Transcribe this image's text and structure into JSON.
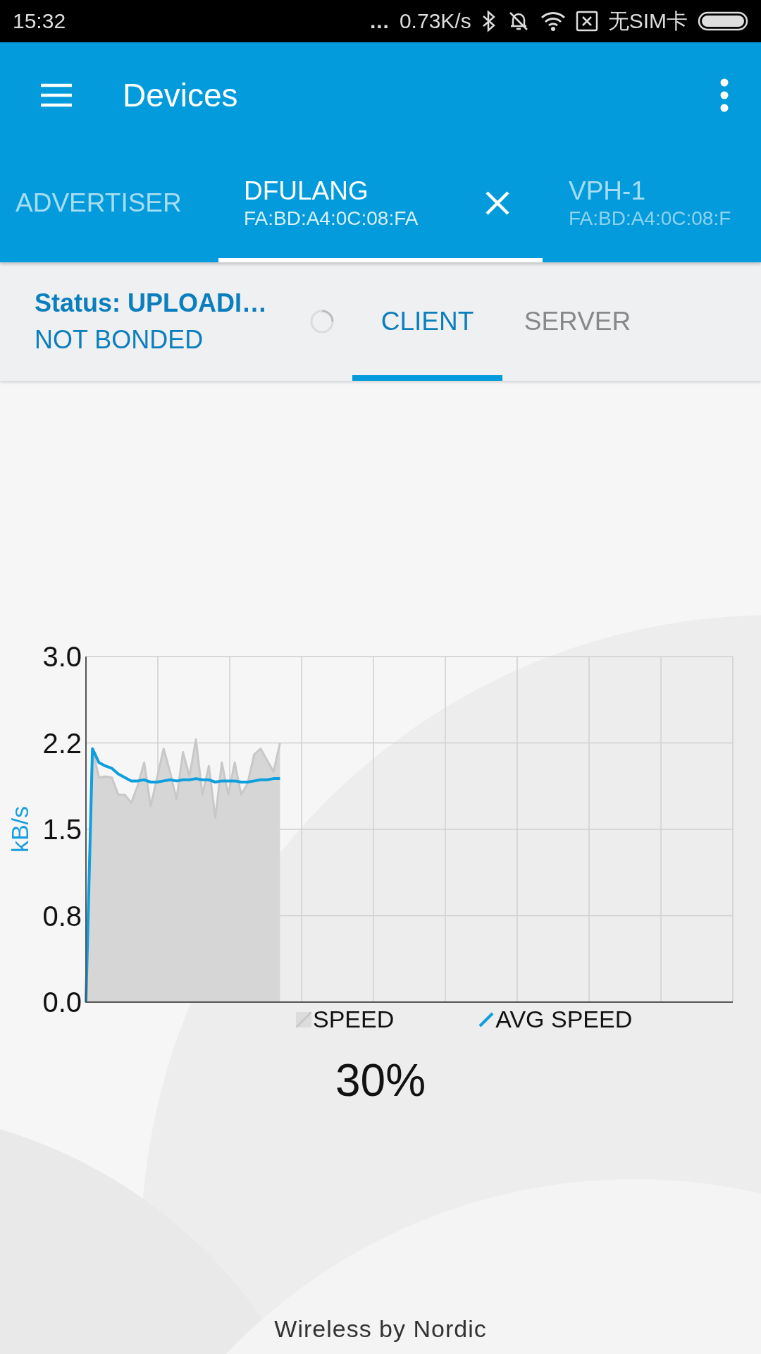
{
  "status_bar": {
    "time": "15:32",
    "dots": "...",
    "speed": "0.73K/s",
    "sim": "无SIM卡"
  },
  "app_bar": {
    "title": "Devices"
  },
  "device_tabs": [
    {
      "label": "ADVERTISER",
      "selected": false,
      "closable": false
    },
    {
      "label": "DFULANG",
      "address": "FA:BD:A4:0C:08:FA",
      "selected": true,
      "closable": true
    },
    {
      "label": "VPH-1",
      "address": "FA:BD:A4:0C:08:F",
      "selected": false,
      "closable": false
    }
  ],
  "connection": {
    "status": "Status: UPLOADI…",
    "bond": "NOT BONDED",
    "busy": true
  },
  "mode_tabs": [
    {
      "label": "CLIENT",
      "selected": true
    },
    {
      "label": "SERVER",
      "selected": false
    }
  ],
  "chart_data": {
    "type": "line",
    "ylabel": "kB/s",
    "grid": true,
    "legend": true,
    "ylim": [
      0,
      3
    ],
    "yticks": [
      {
        "value": 0,
        "label": "0.0"
      },
      {
        "value": 0.75,
        "label": "0.8"
      },
      1.5,
      {
        "value": 2.25,
        "label": "2.2"
      },
      {
        "value": 3,
        "label": "3.0"
      }
    ],
    "categories": [
      null,
      null,
      null,
      null,
      null,
      null,
      null,
      null,
      null,
      null,
      null,
      null,
      null,
      null,
      null,
      null,
      null,
      null,
      null,
      null,
      null,
      null,
      null,
      null,
      null,
      null,
      null,
      null,
      null,
      null,
      null,
      null,
      null,
      null,
      null,
      null,
      null,
      null,
      null,
      null,
      null,
      null,
      null,
      null,
      null,
      null,
      null,
      null,
      null,
      null,
      null,
      null,
      null,
      null,
      null,
      null,
      null,
      null,
      null,
      null,
      null,
      null,
      null,
      null,
      null,
      null,
      null,
      null,
      null,
      null,
      null,
      null,
      null,
      null,
      null,
      null,
      null,
      null,
      null,
      null,
      null,
      null,
      null,
      null,
      null,
      null,
      null,
      null,
      null,
      null,
      null,
      null,
      null,
      null,
      null,
      null,
      null,
      null,
      null,
      null,
      null
    ],
    "series": [
      {
        "name": "SPEED",
        "color": "#c8c8c8",
        "values": [
          0,
          2.2,
          1.95,
          1.96,
          1.95,
          1.8,
          1.8,
          1.73,
          1.88,
          2.08,
          1.7,
          1.95,
          2.2,
          2.0,
          1.76,
          2.17,
          1.96,
          2.28,
          1.8,
          2.05,
          1.6,
          2.08,
          1.8,
          2.08,
          1.8,
          1.9,
          2.15,
          2.2,
          2.1,
          2.0,
          2.25,
          null,
          null,
          null,
          null,
          null,
          null,
          null,
          null,
          null,
          null,
          null,
          null,
          null,
          null,
          null,
          null,
          null,
          null,
          null,
          null,
          null,
          null,
          null,
          null,
          null,
          null,
          null,
          null,
          null,
          null,
          null,
          null,
          null,
          null,
          null,
          null,
          null,
          null,
          null,
          null,
          null,
          null,
          null,
          null,
          null,
          null,
          null,
          null,
          null,
          null,
          null,
          null,
          null,
          null,
          null,
          null,
          null,
          null,
          null,
          null,
          null,
          null,
          null,
          null,
          null,
          null,
          null,
          null,
          null,
          null
        ]
      },
      {
        "name": "AVG SPEED",
        "color": "#0f9ede",
        "values": [
          0,
          2.2,
          2.08,
          2.05,
          2.03,
          1.98,
          1.95,
          1.92,
          1.92,
          1.93,
          1.91,
          1.91,
          1.92,
          1.93,
          1.92,
          1.93,
          1.93,
          1.94,
          1.93,
          1.93,
          1.91,
          1.92,
          1.92,
          1.92,
          1.91,
          1.91,
          1.92,
          1.93,
          1.93,
          1.94,
          1.94,
          null,
          null,
          null,
          null,
          null,
          null,
          null,
          null,
          null,
          null,
          null,
          null,
          null,
          null,
          null,
          null,
          null,
          null,
          null,
          null,
          null,
          null,
          null,
          null,
          null,
          null,
          null,
          null,
          null,
          null,
          null,
          null,
          null,
          null,
          null,
          null,
          null,
          null,
          null,
          null,
          null,
          null,
          null,
          null,
          null,
          null,
          null,
          null,
          null,
          null,
          null,
          null,
          null,
          null,
          null,
          null,
          null,
          null,
          null,
          null,
          null,
          null,
          null,
          null,
          null,
          null,
          null,
          null,
          null,
          null
        ]
      }
    ]
  },
  "progress": "30%",
  "footer": "Wireless by Nordic"
}
